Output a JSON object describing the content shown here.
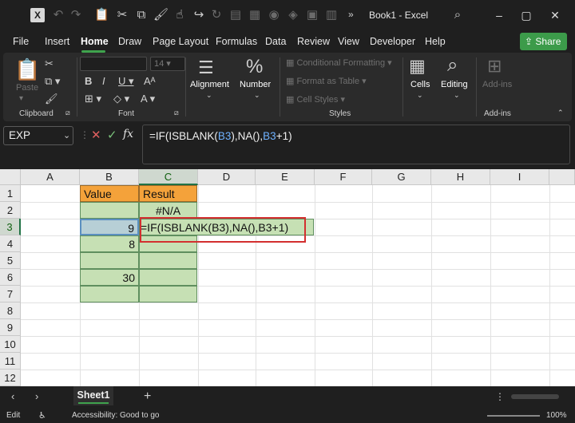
{
  "window": {
    "title": "Book1",
    "separator": " - ",
    "app": "Excel",
    "chevrons": "»",
    "logo": "X",
    "controls": [
      "–",
      "▢",
      "✕"
    ]
  },
  "menu": {
    "items": [
      "File",
      "Insert",
      "Home",
      "Draw",
      "Page Layout",
      "Formulas",
      "Data",
      "Review",
      "View",
      "Developer",
      "Help"
    ],
    "share": "Share"
  },
  "ribbon": {
    "paste": "Paste",
    "clipboard": "Clipboard",
    "font_size": "14",
    "font": "Font",
    "alignment": "Alignment",
    "number": "Number",
    "conditional_formatting": "Conditional Formatting",
    "format_as_table": "Format as Table",
    "cell_styles": "Cell Styles",
    "styles": "Styles",
    "cells": "Cells",
    "editing": "Editing",
    "add_ins": "Add-ins",
    "add_ins_group": "Add-ins"
  },
  "formula_bar": {
    "name_box": "EXP",
    "fx": "fx",
    "formula_parts": [
      "=IF(ISBLANK(",
      "B3",
      "),NA(),",
      "B3",
      "+1)"
    ]
  },
  "grid": {
    "columns": [
      "A",
      "B",
      "C",
      "D",
      "E",
      "F",
      "G",
      "H",
      "I"
    ],
    "rows": [
      "1",
      "2",
      "3",
      "4",
      "5",
      "6",
      "7",
      "8",
      "9",
      "10",
      "11",
      "12"
    ],
    "cells": {
      "B1": "Value",
      "C1": "Result",
      "C2": "#N/A",
      "B3": "9",
      "C3": "=IF(ISBLANK(B3),NA(),B3+1)",
      "B4": "8",
      "B6": "30"
    }
  },
  "tabs": {
    "sheet": "Sheet1",
    "add": "+"
  },
  "status": {
    "mode": "Edit",
    "accessibility": "Accessibility: Good to go",
    "zoom": "100%"
  }
}
